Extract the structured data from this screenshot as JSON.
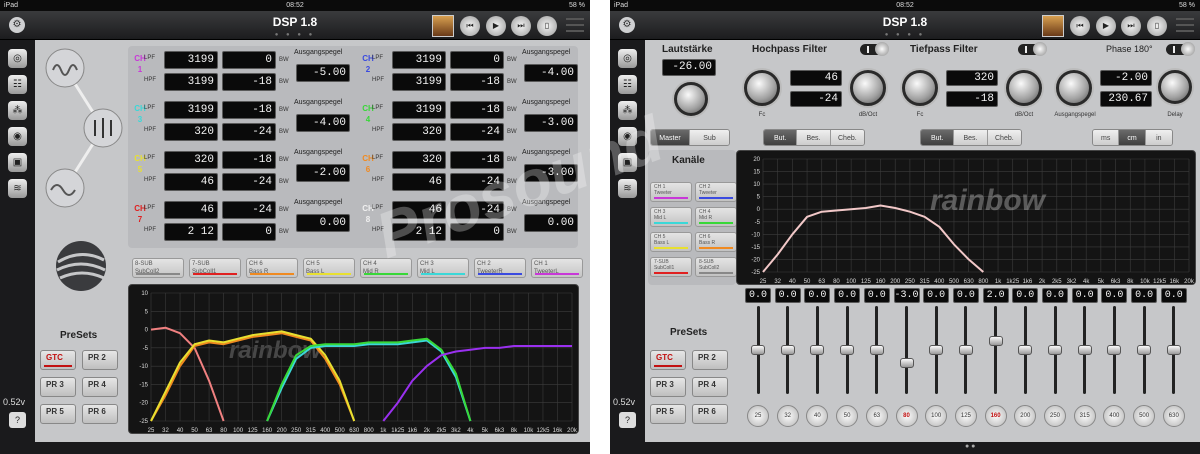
{
  "status": {
    "carrier": "iPad",
    "time": "08:52",
    "battery": "58 %"
  },
  "app_title": "DSP 1.8",
  "voltage": "0.52v",
  "help": "?",
  "gear_icon": "gear-icon",
  "transport_icons": [
    "rewind-icon",
    "play-icon",
    "forward-icon",
    "remote-icon"
  ],
  "left": {
    "labels": {
      "lpf": "LPF",
      "hpf": "HPF",
      "bw": "BW",
      "output": "Ausgangspegel",
      "ch": "CH"
    },
    "channels": [
      {
        "num": "1",
        "color": "#c838d8",
        "lpf_f": "3199",
        "lpf_s": "0",
        "hpf_f": "3199",
        "hpf_s": "-18",
        "out": "-5.00"
      },
      {
        "num": "2",
        "color": "#3a4ae0",
        "lpf_f": "3199",
        "lpf_s": "0",
        "hpf_f": "3199",
        "hpf_s": "-18",
        "out": "-4.00"
      },
      {
        "num": "3",
        "color": "#3ad8d8",
        "lpf_f": "3199",
        "lpf_s": "-18",
        "hpf_f": "320",
        "hpf_s": "-24",
        "out": "-4.00"
      },
      {
        "num": "4",
        "color": "#38d838",
        "lpf_f": "3199",
        "lpf_s": "-18",
        "hpf_f": "320",
        "hpf_s": "-24",
        "out": "-3.00"
      },
      {
        "num": "5",
        "color": "#e8e030",
        "lpf_f": "320",
        "lpf_s": "-18",
        "hpf_f": "46",
        "hpf_s": "-24",
        "out": "-2.00"
      },
      {
        "num": "6",
        "color": "#f08a20",
        "lpf_f": "320",
        "lpf_s": "-18",
        "hpf_f": "46",
        "hpf_s": "-24",
        "out": "-3.00"
      },
      {
        "num": "7",
        "color": "#e02020",
        "lpf_f": "46",
        "lpf_s": "-24",
        "hpf_f": "2 12",
        "hpf_s": "0",
        "out": "0.00"
      },
      {
        "num": "8",
        "color": "#f0f0f0",
        "lpf_f": "46",
        "lpf_s": "-24",
        "hpf_f": "2 12",
        "hpf_s": "0",
        "out": "0.00"
      }
    ],
    "channel_buttons": [
      {
        "top": "8-SUB",
        "bottom": "SubColl2",
        "color": "#888888"
      },
      {
        "top": "7-SUB",
        "bottom": "SubColl1",
        "color": "#e02020"
      },
      {
        "top": "CH 6",
        "bottom": "Bass R",
        "color": "#f08a20"
      },
      {
        "top": "CH 5",
        "bottom": "Bass L",
        "color": "#e8e030"
      },
      {
        "top": "CH 4",
        "bottom": "Mid R",
        "color": "#38d838"
      },
      {
        "top": "CH 3",
        "bottom": "Mid L",
        "color": "#3ad8d8"
      },
      {
        "top": "CH 2",
        "bottom": "TweeterR",
        "color": "#3a4ae0"
      },
      {
        "top": "CH 1",
        "bottom": "TweeterL",
        "color": "#c838d8"
      }
    ],
    "presets_title": "PreSets",
    "presets": [
      "GTC",
      "PR 2",
      "PR 3",
      "PR 4",
      "PR 5",
      "PR 6"
    ],
    "logo_text": "rainbow"
  },
  "chart_data": [
    {
      "type": "line",
      "title": "",
      "xlabel": "",
      "ylabel": "",
      "ylim": [
        -25,
        10
      ],
      "yticks": [
        "10",
        "5",
        "0",
        "-5",
        "-10",
        "-15",
        "-20",
        "-25"
      ],
      "x": [
        "25",
        "32",
        "40",
        "50",
        "63",
        "80",
        "100",
        "125",
        "160",
        "200",
        "250",
        "315",
        "400",
        "500",
        "630",
        "800",
        "1k",
        "1k25",
        "1k6",
        "2k",
        "2k5",
        "3k2",
        "4k",
        "5k",
        "6k3",
        "8k",
        "10k",
        "12k5",
        "16k",
        "20k"
      ],
      "series": [
        {
          "color": "#f08080",
          "values": [
            0,
            0.5,
            -1,
            -5,
            -14,
            -25,
            null,
            null,
            null,
            null,
            null,
            null,
            null,
            null,
            null,
            null,
            null,
            null,
            null,
            null,
            null,
            null,
            null,
            null,
            null,
            null,
            null,
            null,
            null,
            null
          ]
        },
        {
          "color": "#f08a20",
          "values": [
            -25,
            -18,
            -10,
            -4.5,
            -3.5,
            -4,
            -3,
            -2,
            -1.5,
            -1,
            -2,
            -3,
            -8,
            -15,
            -25,
            null,
            null,
            null,
            null,
            null,
            null,
            null,
            null,
            null,
            null,
            null,
            null,
            null,
            null,
            null
          ]
        },
        {
          "color": "#e8e030",
          "values": [
            -25,
            -17,
            -9,
            -4,
            -3,
            -3.5,
            -2.5,
            -1.5,
            -1,
            -0.5,
            -1.5,
            -2.5,
            -7,
            -14,
            -25,
            null,
            null,
            null,
            null,
            null,
            null,
            null,
            null,
            null,
            null,
            null,
            null,
            null,
            null,
            null
          ]
        },
        {
          "color": "#3ad8d8",
          "values": [
            null,
            null,
            null,
            null,
            null,
            null,
            null,
            null,
            -25,
            -16,
            -8,
            -5,
            -4.5,
            -4.5,
            -4.5,
            -4,
            -4,
            -4,
            -3.5,
            -3,
            -6,
            -13,
            -25,
            null,
            null,
            null,
            null,
            null,
            null,
            null
          ]
        },
        {
          "color": "#38d838",
          "values": [
            null,
            null,
            null,
            null,
            null,
            null,
            null,
            null,
            -25,
            -15,
            -7,
            -4.5,
            -4,
            -4,
            -4,
            -3.5,
            -3.5,
            -3.5,
            -3,
            -2.5,
            -5.5,
            -12,
            -25,
            null,
            null,
            null,
            null,
            null,
            null,
            null
          ]
        },
        {
          "color": "#9a30f0",
          "values": [
            null,
            null,
            null,
            null,
            null,
            null,
            null,
            null,
            null,
            null,
            null,
            null,
            null,
            null,
            null,
            null,
            -25,
            -20,
            -14,
            -10,
            -7,
            -6,
            -5.5,
            -5,
            -5,
            -4.5,
            -4.5,
            -4.5,
            -4.5,
            -4.5
          ]
        }
      ]
    },
    {
      "type": "line",
      "title": "",
      "xlabel": "",
      "ylabel": "",
      "ylim": [
        -25,
        20
      ],
      "yticks": [
        "20",
        "15",
        "10",
        "5",
        "0",
        "-5",
        "-10",
        "-15",
        "-20",
        "-25"
      ],
      "x": [
        "25",
        "32",
        "40",
        "50",
        "63",
        "80",
        "100",
        "125",
        "160",
        "200",
        "250",
        "315",
        "400",
        "500",
        "630",
        "800",
        "1k",
        "1k25",
        "1k6",
        "2k",
        "2k5",
        "3k2",
        "4k",
        "5k",
        "6k3",
        "8k",
        "10k",
        "12k5",
        "16k",
        "20k"
      ],
      "series": [
        {
          "color": "#f2c8c8",
          "values": [
            -25,
            -18,
            -10,
            -3,
            -1,
            -0.5,
            0,
            0.5,
            1.5,
            0.5,
            -1,
            -3,
            -7,
            -14,
            -20,
            -25,
            null,
            null,
            null,
            null,
            null,
            null,
            null,
            null,
            null,
            null,
            null,
            null,
            null,
            null
          ]
        }
      ]
    }
  ],
  "right": {
    "volume_label": "Lautstärke",
    "volume": "-26.00",
    "hp_label": "Hochpass Filter",
    "hp_fc": "46",
    "hp_db": "-24",
    "fc_label": "Fc",
    "dboct_label": "dB/Oct",
    "lp_label": "Tiefpass Filter",
    "lp_fc": "320",
    "lp_db": "-18",
    "out_label": "Ausgangspegel",
    "out_val": "-2.00",
    "delay_val": "230.67",
    "delay_label": "Delay",
    "phase_label": "Phase 180°",
    "master_tabs": [
      "Master",
      "Sub"
    ],
    "filter_types": [
      "But.",
      "Bes.",
      "Cheb."
    ],
    "units": [
      "ms",
      "cm",
      "in"
    ],
    "kanaele_label": "Kanäle",
    "channels": [
      {
        "top": "CH 1",
        "bottom": "Tweeter",
        "color": "#c838d8"
      },
      {
        "top": "CH 2",
        "bottom": "Tweeter",
        "color": "#3a4ae0"
      },
      {
        "top": "CH 3",
        "bottom": "Mid L",
        "color": "#3ad8d8"
      },
      {
        "top": "CH 4",
        "bottom": "Mid R",
        "color": "#38d838"
      },
      {
        "top": "CH 5",
        "bottom": "Bass L",
        "color": "#e8e030"
      },
      {
        "top": "CH 6",
        "bottom": "Bass R",
        "color": "#f08a20"
      },
      {
        "top": "7-SUB",
        "bottom": "SubColl1",
        "color": "#e02020"
      },
      {
        "top": "8-SUB",
        "bottom": "SubColl2",
        "color": "#888888"
      }
    ],
    "eq_values": [
      "0.0",
      "0.0",
      "0.0",
      "0.0",
      "0.0",
      "-3.0",
      "0.0",
      "0.0",
      "2.0",
      "0.0",
      "0.0",
      "0.0",
      "0.0",
      "0.0",
      "0.0"
    ],
    "eq_levels": [
      0,
      0,
      0,
      0,
      0,
      -3,
      0,
      0,
      2,
      0,
      0,
      0,
      0,
      0,
      0
    ],
    "eq_freqs": [
      "25",
      "32",
      "40",
      "50",
      "63",
      "80",
      "100",
      "125",
      "160",
      "200",
      "250",
      "315",
      "400",
      "500",
      "630"
    ],
    "eq_hot": [
      false,
      false,
      false,
      false,
      false,
      true,
      false,
      false,
      true,
      false,
      false,
      false,
      false,
      false,
      false
    ],
    "presets_title": "PreSets",
    "presets": [
      "GTC",
      "PR 2",
      "PR 3",
      "PR 4",
      "PR 5",
      "PR 6"
    ]
  },
  "watermark": {
    "main": "Prosound",
    "sub": "rainbow"
  }
}
